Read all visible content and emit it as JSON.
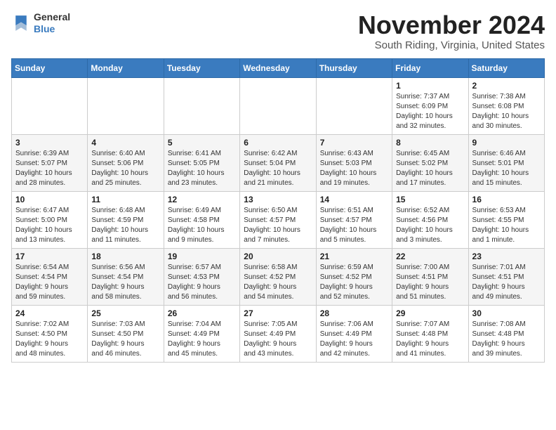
{
  "header": {
    "logo_line1": "General",
    "logo_line2": "Blue",
    "month_title": "November 2024",
    "location": "South Riding, Virginia, United States"
  },
  "weekdays": [
    "Sunday",
    "Monday",
    "Tuesday",
    "Wednesday",
    "Thursday",
    "Friday",
    "Saturday"
  ],
  "rows": [
    [
      {
        "day": "",
        "info": ""
      },
      {
        "day": "",
        "info": ""
      },
      {
        "day": "",
        "info": ""
      },
      {
        "day": "",
        "info": ""
      },
      {
        "day": "",
        "info": ""
      },
      {
        "day": "1",
        "info": "Sunrise: 7:37 AM\nSunset: 6:09 PM\nDaylight: 10 hours\nand 32 minutes."
      },
      {
        "day": "2",
        "info": "Sunrise: 7:38 AM\nSunset: 6:08 PM\nDaylight: 10 hours\nand 30 minutes."
      }
    ],
    [
      {
        "day": "3",
        "info": "Sunrise: 6:39 AM\nSunset: 5:07 PM\nDaylight: 10 hours\nand 28 minutes."
      },
      {
        "day": "4",
        "info": "Sunrise: 6:40 AM\nSunset: 5:06 PM\nDaylight: 10 hours\nand 25 minutes."
      },
      {
        "day": "5",
        "info": "Sunrise: 6:41 AM\nSunset: 5:05 PM\nDaylight: 10 hours\nand 23 minutes."
      },
      {
        "day": "6",
        "info": "Sunrise: 6:42 AM\nSunset: 5:04 PM\nDaylight: 10 hours\nand 21 minutes."
      },
      {
        "day": "7",
        "info": "Sunrise: 6:43 AM\nSunset: 5:03 PM\nDaylight: 10 hours\nand 19 minutes."
      },
      {
        "day": "8",
        "info": "Sunrise: 6:45 AM\nSunset: 5:02 PM\nDaylight: 10 hours\nand 17 minutes."
      },
      {
        "day": "9",
        "info": "Sunrise: 6:46 AM\nSunset: 5:01 PM\nDaylight: 10 hours\nand 15 minutes."
      }
    ],
    [
      {
        "day": "10",
        "info": "Sunrise: 6:47 AM\nSunset: 5:00 PM\nDaylight: 10 hours\nand 13 minutes."
      },
      {
        "day": "11",
        "info": "Sunrise: 6:48 AM\nSunset: 4:59 PM\nDaylight: 10 hours\nand 11 minutes."
      },
      {
        "day": "12",
        "info": "Sunrise: 6:49 AM\nSunset: 4:58 PM\nDaylight: 10 hours\nand 9 minutes."
      },
      {
        "day": "13",
        "info": "Sunrise: 6:50 AM\nSunset: 4:57 PM\nDaylight: 10 hours\nand 7 minutes."
      },
      {
        "day": "14",
        "info": "Sunrise: 6:51 AM\nSunset: 4:57 PM\nDaylight: 10 hours\nand 5 minutes."
      },
      {
        "day": "15",
        "info": "Sunrise: 6:52 AM\nSunset: 4:56 PM\nDaylight: 10 hours\nand 3 minutes."
      },
      {
        "day": "16",
        "info": "Sunrise: 6:53 AM\nSunset: 4:55 PM\nDaylight: 10 hours\nand 1 minute."
      }
    ],
    [
      {
        "day": "17",
        "info": "Sunrise: 6:54 AM\nSunset: 4:54 PM\nDaylight: 9 hours\nand 59 minutes."
      },
      {
        "day": "18",
        "info": "Sunrise: 6:56 AM\nSunset: 4:54 PM\nDaylight: 9 hours\nand 58 minutes."
      },
      {
        "day": "19",
        "info": "Sunrise: 6:57 AM\nSunset: 4:53 PM\nDaylight: 9 hours\nand 56 minutes."
      },
      {
        "day": "20",
        "info": "Sunrise: 6:58 AM\nSunset: 4:52 PM\nDaylight: 9 hours\nand 54 minutes."
      },
      {
        "day": "21",
        "info": "Sunrise: 6:59 AM\nSunset: 4:52 PM\nDaylight: 9 hours\nand 52 minutes."
      },
      {
        "day": "22",
        "info": "Sunrise: 7:00 AM\nSunset: 4:51 PM\nDaylight: 9 hours\nand 51 minutes."
      },
      {
        "day": "23",
        "info": "Sunrise: 7:01 AM\nSunset: 4:51 PM\nDaylight: 9 hours\nand 49 minutes."
      }
    ],
    [
      {
        "day": "24",
        "info": "Sunrise: 7:02 AM\nSunset: 4:50 PM\nDaylight: 9 hours\nand 48 minutes."
      },
      {
        "day": "25",
        "info": "Sunrise: 7:03 AM\nSunset: 4:50 PM\nDaylight: 9 hours\nand 46 minutes."
      },
      {
        "day": "26",
        "info": "Sunrise: 7:04 AM\nSunset: 4:49 PM\nDaylight: 9 hours\nand 45 minutes."
      },
      {
        "day": "27",
        "info": "Sunrise: 7:05 AM\nSunset: 4:49 PM\nDaylight: 9 hours\nand 43 minutes."
      },
      {
        "day": "28",
        "info": "Sunrise: 7:06 AM\nSunset: 4:49 PM\nDaylight: 9 hours\nand 42 minutes."
      },
      {
        "day": "29",
        "info": "Sunrise: 7:07 AM\nSunset: 4:48 PM\nDaylight: 9 hours\nand 41 minutes."
      },
      {
        "day": "30",
        "info": "Sunrise: 7:08 AM\nSunset: 4:48 PM\nDaylight: 9 hours\nand 39 minutes."
      }
    ]
  ]
}
